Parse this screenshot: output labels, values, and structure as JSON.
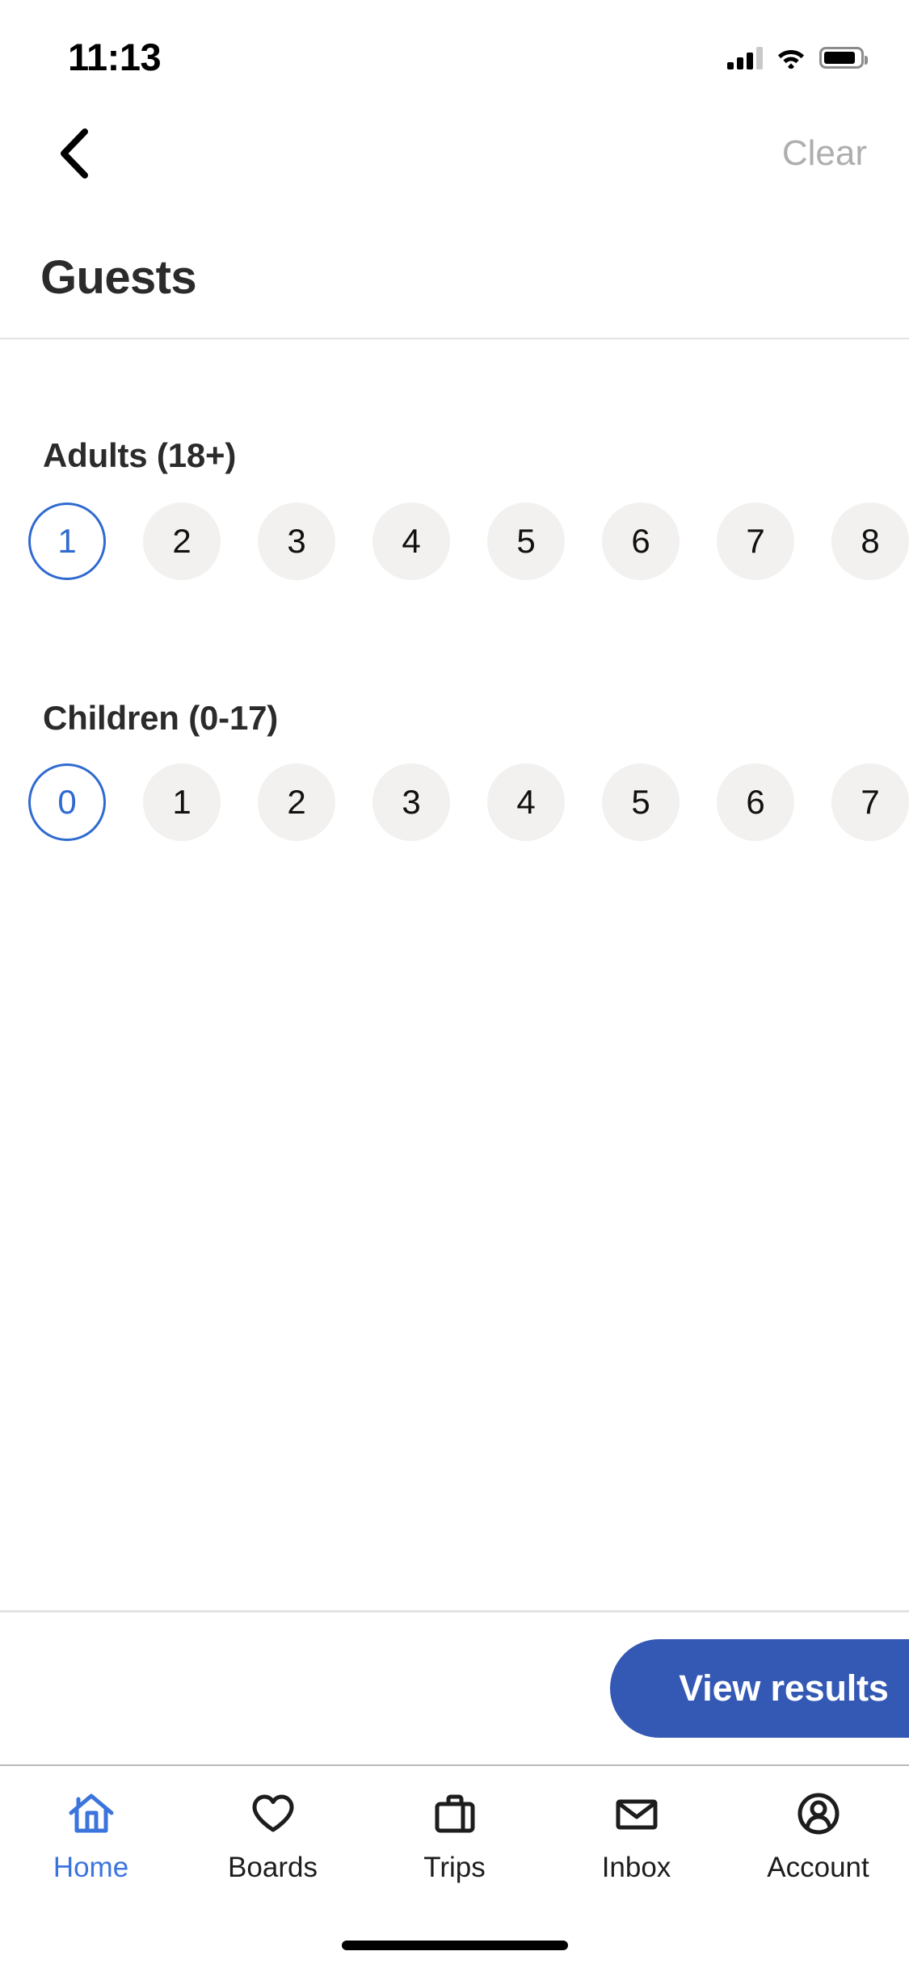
{
  "status_bar": {
    "time": "11:13",
    "signal_icon": "cellular-signal-icon",
    "wifi_icon": "wifi-icon",
    "battery_icon": "battery-icon"
  },
  "nav": {
    "back_icon": "chevron-left-icon",
    "clear_label": "Clear"
  },
  "header": {
    "title": "Guests"
  },
  "sections": [
    {
      "label": "Adults (18+)",
      "selected": "1",
      "options": [
        "1",
        "2",
        "3",
        "4",
        "5",
        "6",
        "7",
        "8"
      ]
    },
    {
      "label": "Children (0-17)",
      "selected": "0",
      "options": [
        "0",
        "1",
        "2",
        "3",
        "4",
        "5",
        "6",
        "7"
      ]
    }
  ],
  "cta": {
    "label": "View results"
  },
  "tabbar": {
    "items": [
      {
        "label": "Home",
        "icon": "home-icon",
        "active": true
      },
      {
        "label": "Boards",
        "icon": "heart-icon",
        "active": false
      },
      {
        "label": "Trips",
        "icon": "suitcase-icon",
        "active": false
      },
      {
        "label": "Inbox",
        "icon": "envelope-icon",
        "active": false
      },
      {
        "label": "Account",
        "icon": "person-circle-icon",
        "active": false
      }
    ]
  },
  "colors": {
    "accent_blue": "#3459b4",
    "selected_ring": "#2f6ad0",
    "tab_active": "#3b74dd",
    "chip_bg": "#f2f1f0",
    "muted_text": "#aeaeae"
  }
}
